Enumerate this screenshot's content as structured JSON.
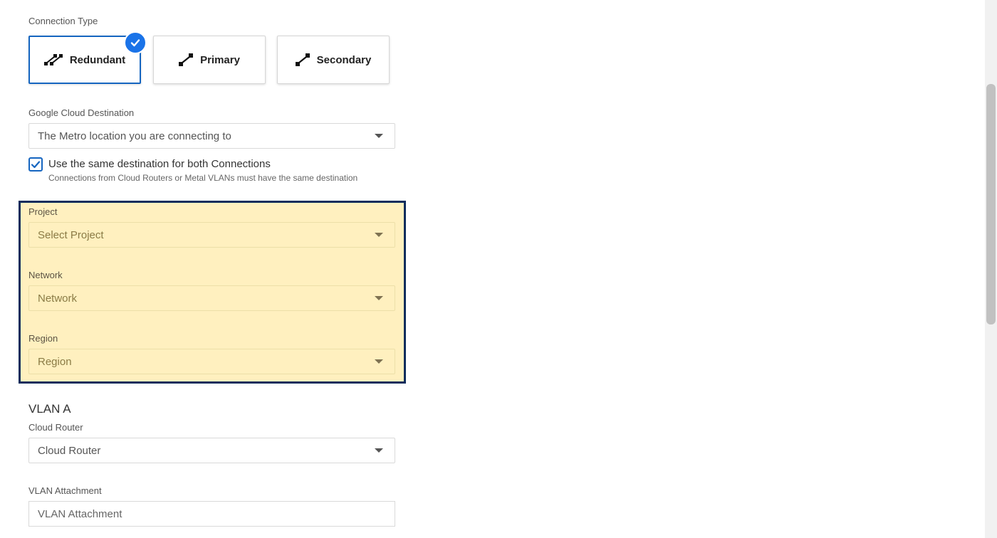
{
  "connection_type": {
    "label": "Connection Type",
    "options": [
      {
        "label": "Redundant",
        "icon": "redundant-connection-icon",
        "selected": true
      },
      {
        "label": "Primary",
        "icon": "single-connection-icon",
        "selected": false
      },
      {
        "label": "Secondary",
        "icon": "single-connection-icon",
        "selected": false
      }
    ]
  },
  "destination": {
    "label": "Google Cloud Destination",
    "placeholder": "The Metro location you are connecting to"
  },
  "same_destination": {
    "checked": true,
    "label": "Use the same destination for both Connections",
    "hint": "Connections from Cloud Routers or Metal VLANs must have the same destination"
  },
  "project": {
    "label": "Project",
    "placeholder": "Select Project"
  },
  "network": {
    "label": "Network",
    "placeholder": "Network"
  },
  "region": {
    "label": "Region",
    "placeholder": "Region"
  },
  "vlan_a": {
    "title": "VLAN A",
    "cloud_router": {
      "label": "Cloud Router",
      "placeholder": "Cloud Router"
    },
    "vlan_attachment": {
      "label": "VLAN Attachment",
      "placeholder": "VLAN Attachment"
    }
  },
  "colors": {
    "accent": "#1a73e8",
    "highlight_fill": "#fff0bf",
    "highlight_border": "#0d2d5c"
  }
}
